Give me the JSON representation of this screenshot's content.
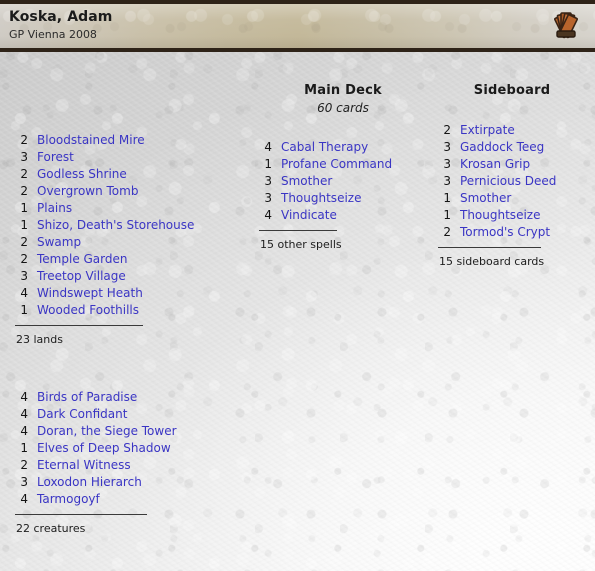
{
  "header": {
    "player_name": "Koska, Adam",
    "event": "GP Vienna 2008",
    "logo_icon": "card-fan-icon"
  },
  "main_deck": {
    "title": "Main Deck",
    "subtitle": "60 cards",
    "lands": {
      "entries": [
        {
          "qty": "2",
          "name": "Bloodstained Mire"
        },
        {
          "qty": "3",
          "name": "Forest"
        },
        {
          "qty": "2",
          "name": "Godless Shrine"
        },
        {
          "qty": "2",
          "name": "Overgrown Tomb"
        },
        {
          "qty": "1",
          "name": "Plains"
        },
        {
          "qty": "1",
          "name": "Shizo, Death's Storehouse"
        },
        {
          "qty": "2",
          "name": "Swamp"
        },
        {
          "qty": "2",
          "name": "Temple Garden"
        },
        {
          "qty": "3",
          "name": "Treetop Village"
        },
        {
          "qty": "4",
          "name": "Windswept Heath"
        },
        {
          "qty": "1",
          "name": "Wooded Foothills"
        }
      ],
      "total": "23 lands"
    },
    "creatures": {
      "entries": [
        {
          "qty": "4",
          "name": "Birds of Paradise"
        },
        {
          "qty": "4",
          "name": "Dark Confidant"
        },
        {
          "qty": "4",
          "name": "Doran, the Siege Tower"
        },
        {
          "qty": "1",
          "name": "Elves of Deep Shadow"
        },
        {
          "qty": "2",
          "name": "Eternal Witness"
        },
        {
          "qty": "3",
          "name": "Loxodon Hierarch"
        },
        {
          "qty": "4",
          "name": "Tarmogoyf"
        }
      ],
      "total": "22 creatures"
    },
    "spells": {
      "entries": [
        {
          "qty": "4",
          "name": "Cabal Therapy"
        },
        {
          "qty": "1",
          "name": "Profane Command"
        },
        {
          "qty": "3",
          "name": "Smother"
        },
        {
          "qty": "3",
          "name": "Thoughtseize"
        },
        {
          "qty": "4",
          "name": "Vindicate"
        }
      ],
      "total": "15 other spells"
    }
  },
  "sideboard": {
    "title": "Sideboard",
    "entries": [
      {
        "qty": "2",
        "name": "Extirpate"
      },
      {
        "qty": "3",
        "name": "Gaddock Teeg"
      },
      {
        "qty": "3",
        "name": "Krosan Grip"
      },
      {
        "qty": "3",
        "name": "Pernicious Deed"
      },
      {
        "qty": "1",
        "name": "Smother"
      },
      {
        "qty": "1",
        "name": "Thoughtseize"
      },
      {
        "qty": "2",
        "name": "Tormod's Crypt"
      }
    ],
    "total": "15 sideboard cards"
  },
  "colors": {
    "card_link": "#3a35c4",
    "header_border": "#2e2318",
    "text": "#141414"
  }
}
